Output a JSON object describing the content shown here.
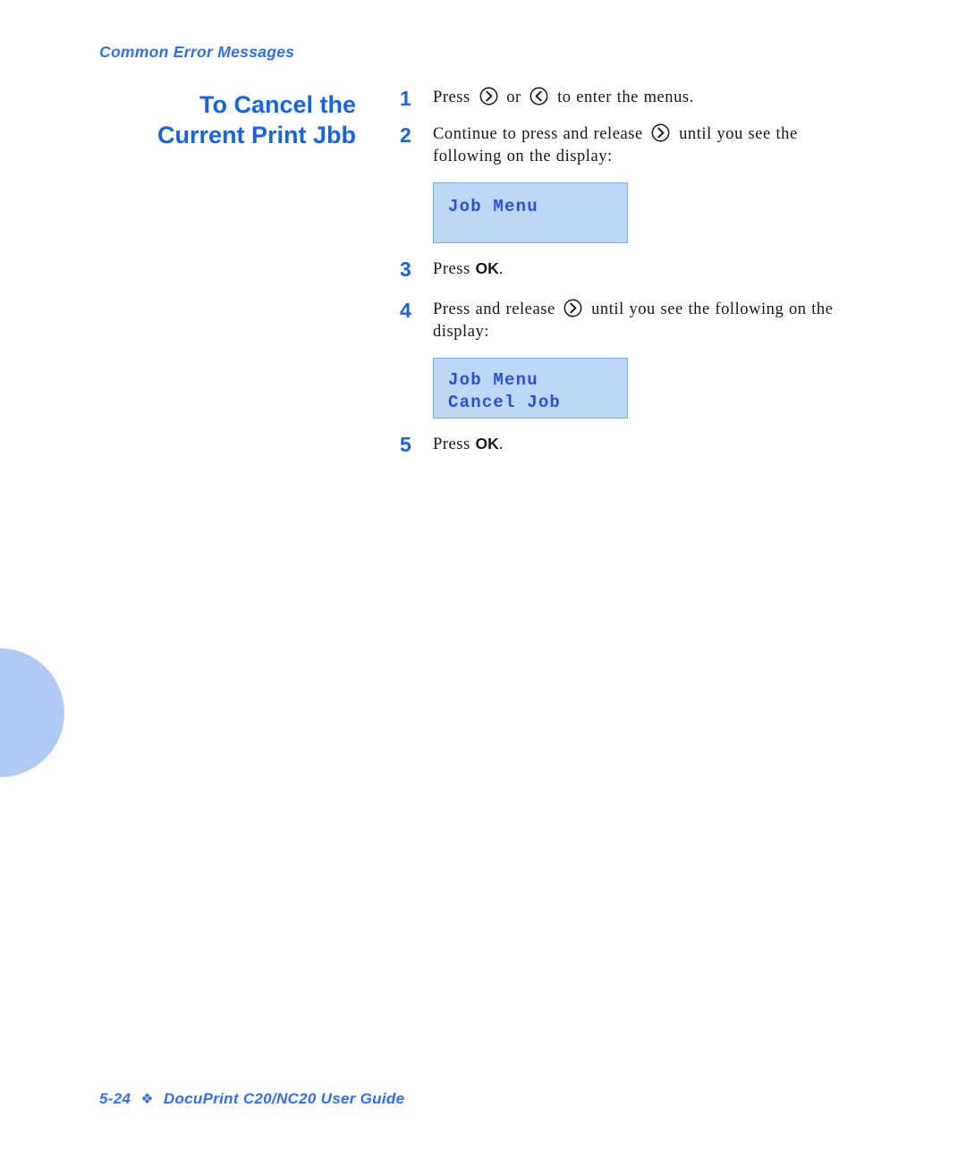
{
  "header": {
    "running_title": "Common Error Messages"
  },
  "section": {
    "title_line1": "To Cancel the",
    "title_line2": "Current Print Jbb"
  },
  "procedure": {
    "steps": [
      {
        "number": "1",
        "text_before": "Press",
        "icon_right": "arrow-right-button-icon",
        "text_middle": "or",
        "icon_left": "arrow-left-button-icon",
        "text_after": "to enter the menus."
      },
      {
        "number": "2",
        "text_before": "Continue to press and release",
        "icon_right": "arrow-right-button-icon",
        "text_after": "until you see the following on the display:"
      },
      {
        "number": "3",
        "text_before": "Press",
        "emphasis": "OK",
        "text_after": "."
      },
      {
        "number": "4",
        "text_before": "Press and release",
        "icon_right": "arrow-right-button-icon",
        "text_after": "until you see the following on the display:"
      },
      {
        "number": "5",
        "text_before": "Press",
        "emphasis": "OK",
        "text_after": "."
      }
    ]
  },
  "displays": [
    {
      "name": "job-menu-display",
      "line1": "Job Menu",
      "line2": ""
    },
    {
      "name": "cancel-job-display",
      "line1": "Job Menu",
      "line2": "Cancel Job"
    }
  ],
  "footer": {
    "page_number": "5-24",
    "separator": "❖",
    "guide_title": "DocuPrint C20/NC20 User Guide"
  },
  "colors": {
    "accent_blue": "#1763e8",
    "header_blue": "#2f6ff0",
    "lcd_fill": "#bdd7f7",
    "lcd_border": "#7aaeea",
    "lcd_text": "#2a4fd8",
    "tab_marker": "#b0caf8",
    "body_text": "#17171a"
  }
}
